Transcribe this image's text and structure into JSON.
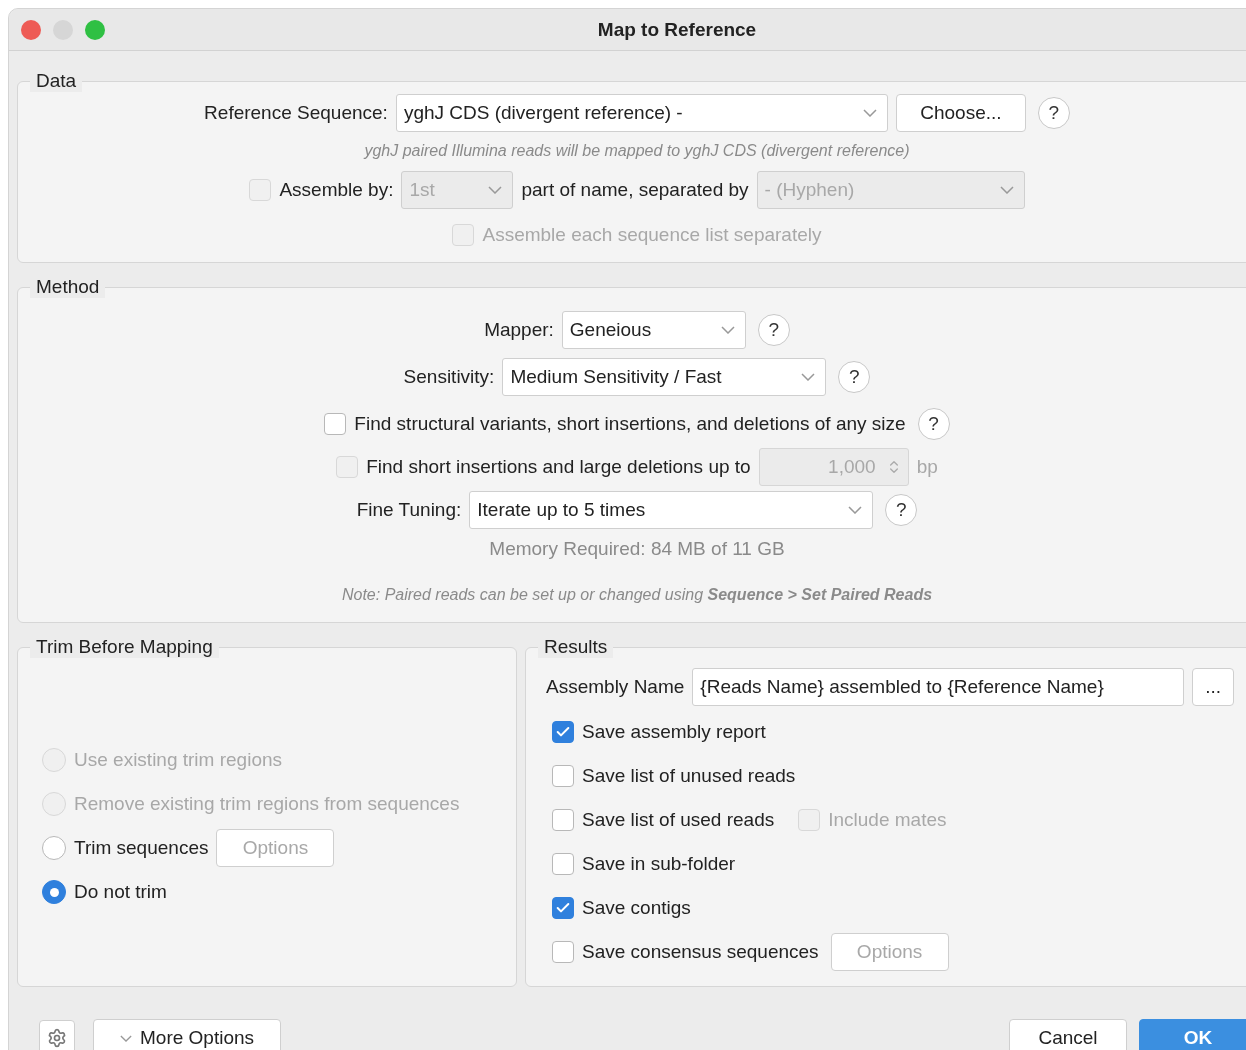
{
  "window": {
    "title": "Map to Reference"
  },
  "data": {
    "legend": "Data",
    "reference": {
      "label": "Reference Sequence:",
      "value": "yghJ CDS (divergent reference) -",
      "button": "Choose...",
      "help": "?"
    },
    "note": "yghJ paired Illumina reads will be mapped to yghJ CDS (divergent reference)",
    "assemble_by": {
      "label": "Assemble by:",
      "checked": false,
      "part": "1st",
      "middle": "part of name, separated by",
      "separator": "- (Hyphen)",
      "disabled": true
    },
    "each_list": {
      "label": "Assemble each sequence list separately",
      "checked": false,
      "disabled": true
    }
  },
  "method": {
    "legend": "Method",
    "mapper": {
      "label": "Mapper:",
      "value": "Geneious",
      "help": "?"
    },
    "sensitivity": {
      "label": "Sensitivity:",
      "value": "Medium Sensitivity / Fast",
      "help": "?"
    },
    "structural": {
      "label": "Find structural variants, short insertions, and deletions of any size",
      "checked": false,
      "help": "?"
    },
    "short_insertions": {
      "label": "Find short insertions and large deletions up to",
      "checked": false,
      "value": "1,000",
      "unit": "bp",
      "disabled": true
    },
    "fine_tuning": {
      "label": "Fine Tuning:",
      "value": "Iterate up to 5 times",
      "help": "?"
    },
    "memory": "Memory Required: 84 MB of 11 GB",
    "note": "Note: Paired reads can be set up or changed using **Sequence > Set Paired Reads**"
  },
  "trim": {
    "legend": "Trim Before Mapping",
    "options": [
      {
        "label": "Use existing trim regions",
        "selected": false,
        "disabled": true
      },
      {
        "label": "Remove existing trim regions from sequences",
        "selected": false,
        "disabled": true
      },
      {
        "label": "Trim sequences",
        "selected": false,
        "disabled": false,
        "button": {
          "label": "Options",
          "disabled": true
        }
      },
      {
        "label": "Do not trim",
        "selected": true,
        "disabled": false
      }
    ]
  },
  "results": {
    "legend": "Results",
    "assembly_name": {
      "label": "Assembly Name",
      "value": "{Reads Name} assembled to {Reference Name}",
      "button": "..."
    },
    "options": [
      {
        "label": "Save assembly report",
        "checked": true
      },
      {
        "label": "Save list of unused reads",
        "checked": false
      },
      {
        "label": "Save list of used reads",
        "checked": false,
        "extra": {
          "label": "Include mates",
          "checked": false,
          "disabled": true
        }
      },
      {
        "label": "Save in sub-folder",
        "checked": false
      },
      {
        "label": "Save contigs",
        "checked": true
      },
      {
        "label": "Save consensus sequences",
        "checked": false,
        "button": {
          "label": "Options",
          "disabled": true
        }
      }
    ]
  },
  "footer": {
    "more_options": "More Options",
    "cancel": "Cancel",
    "ok": "OK"
  }
}
